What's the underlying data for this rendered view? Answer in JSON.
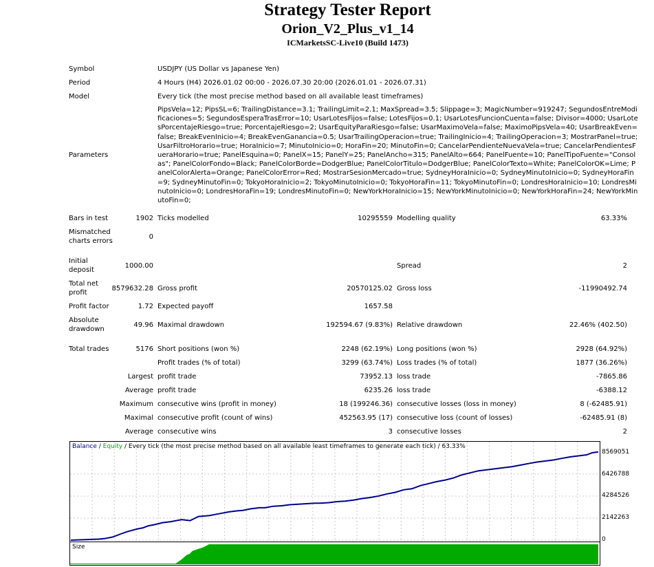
{
  "report": {
    "title": "Strategy Tester Report",
    "expert": "Orion_V2_Plus_v1_14",
    "server": "ICMarketsSC-Live10 (Build 1473)"
  },
  "info": {
    "symbol_label": "Symbol",
    "symbol_value": "USDJPY (US Dollar vs Japanese Yen)",
    "period_label": "Period",
    "period_value": "4 Hours (H4) 2026.01.02 00:00 - 2026.07.30 20:00 (2026.01.01 - 2026.07.31)",
    "model_label": "Model",
    "model_value": "Every tick (the most precise method based on all available least timeframes)",
    "parameters_label": "Parameters",
    "parameters_value": "PipsVela=12; PipsSL=6; TrailingDistance=3.1; TrailingLimit=2.1; MaxSpread=3.5; Slippage=3; MagicNumber=919247; SegundosEntreModificaciones=5; SegundosEsperaTrasError=10; UsarLotesFijos=false; LotesFijos=0.1; UsarLotesFuncionCuenta=false; Divisor=4000; UsarLotesPorcentajeRiesgo=true; PorcentajeRiesgo=2; UsarEquityParaRiesgo=false; UsarMaximoVela=false; MaximoPipsVela=40; UsarBreakEven=false; BreakEvenInicio=4; BreakEvenGanancia=0.5; UsarTrailingOperacion=true; TrailingInicio=4; TrailingOperacion=3; MostrarPanel=true; UsarFiltroHorario=true; HoraInicio=7; MinutoInicio=0; HoraFin=20; MinutoFin=0; CancelarPendienteNuevaVela=true; CancelarPendientesFueraHorario=true; PanelEsquina=0; PanelX=15; PanelY=25; PanelAncho=315; PanelAlto=664; PanelFuente=10; PanelTipoFuente=\"Consolas\"; PanelColorFondo=Black; PanelColorBorde=DodgerBlue; PanelColorTitulo=DodgerBlue; PanelColorTexto=White; PanelColorOK=Lime; PanelColorAlerta=Orange; PanelColorError=Red; MostrarSesionMercado=true; SydneyHoraInicio=0; SydneyMinutoInicio=0; SydneyHoraFin=9; SydneyMinutoFin=0; TokyoHoraInicio=2; TokyoMinutoInicio=0; TokyoHoraFin=11; TokyoMinutoFin=0; LondresHoraInicio=10; LondresMinutoInicio=0; LondresHoraFin=19; LondresMinutoFin=0; NewYorkHoraInicio=15; NewYorkMinutoInicio=0; NewYorkHoraFin=24; NewYorkMinutoFin=0;"
  },
  "stats": {
    "bars_label": "Bars in test",
    "bars_value": "1902",
    "ticks_label": "Ticks modelled",
    "ticks_value": "10295559",
    "quality_label": "Modelling quality",
    "quality_value": "63.33%",
    "mismatch_label_1": "Mismatched",
    "mismatch_label_2": "charts errors",
    "mismatch_value": "0",
    "deposit_label_1": "Initial",
    "deposit_label_2": "deposit",
    "deposit_value": "1000.00",
    "spread_label": "Spread",
    "spread_value": "2",
    "netprofit_label_1": "Total net",
    "netprofit_label_2": "profit",
    "netprofit_value": "8579632.28",
    "grossprofit_label": "Gross profit",
    "grossprofit_value": "20570125.02",
    "grossloss_label": "Gross loss",
    "grossloss_value": "-11990492.74",
    "pf_label": "Profit factor",
    "pf_value": "1.72",
    "payoff_label": "Expected payoff",
    "payoff_value": "1657.58",
    "absdd_label_1": "Absolute",
    "absdd_label_2": "drawdown",
    "absdd_value": "49.96",
    "maxdd_label": "Maximal drawdown",
    "maxdd_value": "192594.67 (9.83%)",
    "reldd_label": "Relative drawdown",
    "reldd_value": "22.46% (402.50)",
    "trades_label": "Total trades",
    "trades_value": "5176",
    "short_label": "Short positions (won %)",
    "short_value": "2248 (62.19%)",
    "long_label": "Long positions (won %)",
    "long_value": "2928 (64.92%)",
    "ptrades_label": "Profit trades (% of total)",
    "ptrades_value": "3299 (63.74%)",
    "ltrades_label": "Loss trades (% of total)",
    "ltrades_value": "1877 (36.26%)",
    "largest_label": "Largest",
    "largest_profit_label": "profit trade",
    "largest_profit_value": "73952.13",
    "largest_loss_label": "loss trade",
    "largest_loss_value": "-7865.86",
    "average_label": "Average",
    "average_profit_label": "profit trade",
    "average_profit_value": "6235.26",
    "average_loss_label": "loss trade",
    "average_loss_value": "-6388.12",
    "maximum_label": "Maximum",
    "maxwins_label": "consecutive wins (profit in money)",
    "maxwins_value": "18 (199246.36)",
    "maxlosses_label": "consecutive losses (loss in money)",
    "maxlosses_value": "8 (-62485.91)",
    "maximal_label": "Maximal",
    "maxprofit_label": "consecutive profit (count of wins)",
    "maxprofit_value": "452563.95 (17)",
    "maxloss_label": "consecutive loss (count of losses)",
    "maxloss_value": "-62485.91 (8)",
    "average2_label": "Average",
    "avgwins_label": "consecutive wins",
    "avgwins_value": "3",
    "avglosses_label": "consecutive losses",
    "avglosses_value": "2"
  },
  "chart": {
    "legend_balance": "Balance",
    "legend_sep1": " / ",
    "legend_equity": "Equity",
    "legend_rest": " / Every tick (the most precise method based on all available least timeframes to generate each tick) / 63.33%",
    "y_labels": [
      "8569051",
      "6426788",
      "4284526",
      "2142263",
      "0"
    ],
    "size_label": "Size",
    "balance_color": "#00008b",
    "equity_color": "#00aa00",
    "size_color": "#00aa00"
  },
  "chart_data": {
    "type": "line",
    "ylim": [
      0,
      8569051
    ],
    "series": [
      {
        "name": "Balance",
        "x": [
          0,
          50,
          100,
          120,
          150,
          180,
          200,
          220,
          240,
          260,
          280,
          300,
          330,
          360,
          400,
          430,
          460,
          500,
          520,
          540,
          570,
          600,
          620,
          650,
          680,
          700,
          730,
          760,
          790,
          820,
          850,
          880,
          900,
          930,
          960,
          990,
          1020,
          1050,
          1080,
          1110,
          1140,
          1170,
          1200,
          1230,
          1260,
          1290,
          1320,
          1350,
          1380,
          1410,
          1440,
          1470,
          1500,
          1530,
          1560,
          1590,
          1620,
          1650,
          1680,
          1710,
          1740,
          1770,
          1800,
          1830,
          1860,
          1880,
          1902
        ],
        "values": [
          1000,
          50000,
          100000,
          150000,
          300000,
          600000,
          800000,
          950000,
          1100000,
          1200000,
          1400000,
          1500000,
          1700000,
          1800000,
          2000000,
          1900000,
          2300000,
          2400000,
          2500000,
          2600000,
          2750000,
          2850000,
          2900000,
          3050000,
          3150000,
          3150000,
          3300000,
          3350000,
          3450000,
          3500000,
          3550000,
          3600000,
          3600000,
          3650000,
          3750000,
          3800000,
          3900000,
          4050000,
          4150000,
          4300000,
          4500000,
          4650000,
          4900000,
          5000000,
          5300000,
          5500000,
          5700000,
          5850000,
          6050000,
          6350000,
          6550000,
          6750000,
          6850000,
          6950000,
          7050000,
          7150000,
          7300000,
          7450000,
          7600000,
          7700000,
          7800000,
          7950000,
          8100000,
          8200000,
          8300000,
          8500000,
          8579632
        ]
      }
    ],
    "size": {
      "x": [
        0,
        380,
        400,
        420,
        430,
        440,
        460,
        480,
        500,
        1902
      ],
      "values": [
        0,
        0,
        0.2,
        0.45,
        0.5,
        0.65,
        0.75,
        0.85,
        1,
        1
      ]
    }
  }
}
